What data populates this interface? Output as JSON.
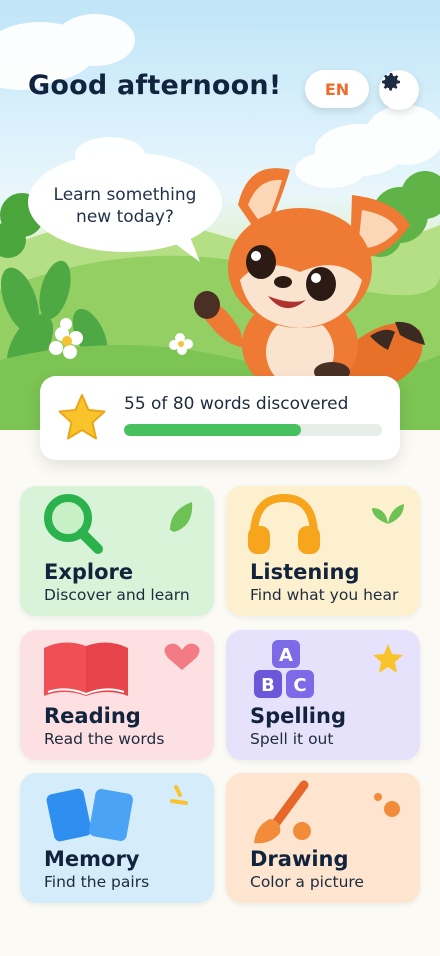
{
  "header": {
    "greeting": "Good afternoon!",
    "language_label": "EN",
    "settings_icon": "gear-icon"
  },
  "mascot": {
    "speech": "Learn something new today?",
    "speech_line1": "Learn something",
    "speech_line2": "new today?"
  },
  "progress": {
    "label": "55 of 80 words discovered",
    "discovered": 55,
    "total": 80,
    "fill_color": "#47c15e",
    "icon": "star-icon"
  },
  "activities": [
    {
      "title": "Explore",
      "subtitle": "Discover and learn",
      "icon": "magnifier-icon",
      "color": "#d8f3d8"
    },
    {
      "title": "Listening",
      "subtitle": "Find what you hear",
      "icon": "headphones-icon",
      "color": "#fdf0cf"
    },
    {
      "title": "Reading",
      "subtitle": "Read the words",
      "icon": "book-icon",
      "color": "#fde0e2"
    },
    {
      "title": "Spelling",
      "subtitle": "Spell it out",
      "icon": "abc-blocks-icon",
      "color": "#e7e2fb"
    },
    {
      "title": "Memory",
      "subtitle": "Find the pairs",
      "icon": "cards-icon",
      "color": "#d5ecfb"
    },
    {
      "title": "Drawing",
      "subtitle": "Color a picture",
      "icon": "paintbrush-icon",
      "color": "#fde5cf"
    }
  ],
  "colors": {
    "accent": "#f06a2a",
    "title": "#12233d"
  }
}
